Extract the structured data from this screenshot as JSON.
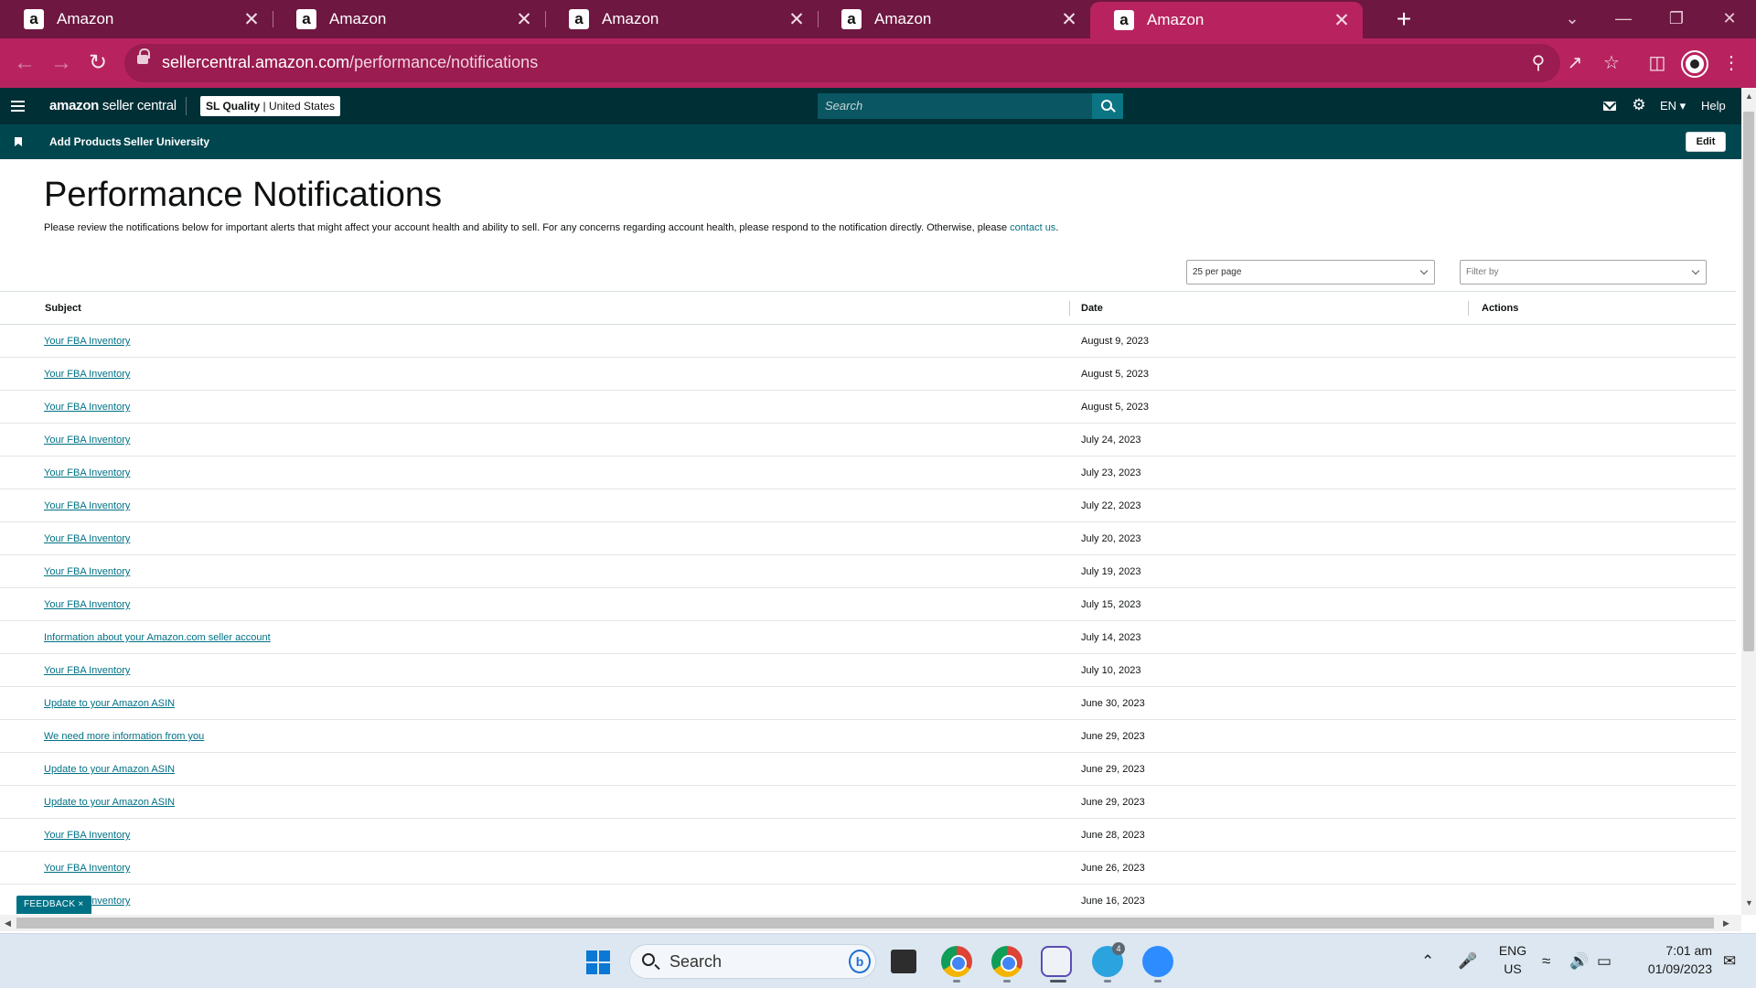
{
  "browser": {
    "tabs": [
      {
        "title": "Amazon",
        "active": false
      },
      {
        "title": "Amazon",
        "active": false
      },
      {
        "title": "Amazon",
        "active": false
      },
      {
        "title": "Amazon",
        "active": false
      },
      {
        "title": "Amazon",
        "active": true
      }
    ],
    "favicon_letter": "a",
    "url_host": "sellercentral.amazon.com",
    "url_path": "/performance/notifications",
    "colors": {
      "tabstrip": "#6e1740",
      "toolbar": "#b8235f"
    }
  },
  "header": {
    "logo_brand": "amazon",
    "logo_suffix": " seller central",
    "store_name": "SL Quality",
    "store_region": "United States",
    "search_placeholder": "Search",
    "language": "EN",
    "help": "Help"
  },
  "subnav": {
    "links": [
      "Add Products",
      "Seller University"
    ],
    "edit_label": "Edit"
  },
  "main": {
    "title": "Performance Notifications",
    "intro": "Please review the notifications below for important alerts that might affect your account health and ability to sell. For any concerns regarding account health, please respond to the notification directly. Otherwise, please ",
    "contact_link": "contact us",
    "intro_end": ".",
    "per_page": "25 per page",
    "filter_placeholder": "Filter by",
    "columns": {
      "subject": "Subject",
      "date": "Date",
      "actions": "Actions"
    },
    "rows": [
      {
        "subject": "Your FBA Inventory",
        "date": "August 9, 2023"
      },
      {
        "subject": "Your FBA Inventory",
        "date": "August 5, 2023"
      },
      {
        "subject": "Your FBA Inventory",
        "date": "August 5, 2023"
      },
      {
        "subject": "Your FBA Inventory",
        "date": "July 24, 2023"
      },
      {
        "subject": "Your FBA Inventory",
        "date": "July 23, 2023"
      },
      {
        "subject": "Your FBA Inventory",
        "date": "July 22, 2023"
      },
      {
        "subject": "Your FBA Inventory",
        "date": "July 20, 2023"
      },
      {
        "subject": "Your FBA Inventory",
        "date": "July 19, 2023"
      },
      {
        "subject": "Your FBA Inventory",
        "date": "July 15, 2023"
      },
      {
        "subject": "Information about your Amazon.com seller account",
        "date": "July 14, 2023"
      },
      {
        "subject": "Your FBA Inventory",
        "date": "July 10, 2023"
      },
      {
        "subject": "Update to your Amazon ASIN",
        "date": "June 30, 2023"
      },
      {
        "subject": "We need more information from you",
        "date": "June 29, 2023"
      },
      {
        "subject": "Update to your Amazon ASIN",
        "date": "June 29, 2023"
      },
      {
        "subject": "Update to your Amazon ASIN",
        "date": "June 29, 2023"
      },
      {
        "subject": "Your FBA Inventory",
        "date": "June 28, 2023"
      },
      {
        "subject": "Your FBA Inventory",
        "date": "June 26, 2023"
      },
      {
        "subject": "Your FBA Inventory",
        "date": "June 16, 2023"
      }
    ],
    "link_color": "#007185"
  },
  "feedback": {
    "label": "FEEDBACK",
    "close": "×"
  },
  "taskbar": {
    "search_placeholder": "Search",
    "badges": {
      "telegram": "4"
    },
    "language_line1": "ENG",
    "language_line2": "US",
    "time": "7:01 am",
    "date": "01/09/2023",
    "icons": [
      "windows-start-icon",
      "search-icon",
      "bing-icon",
      "file-explorer-icon",
      "chrome-icon",
      "chrome-profile-icon",
      "snipping-tool-icon",
      "telegram-icon",
      "zoom-icon"
    ]
  }
}
